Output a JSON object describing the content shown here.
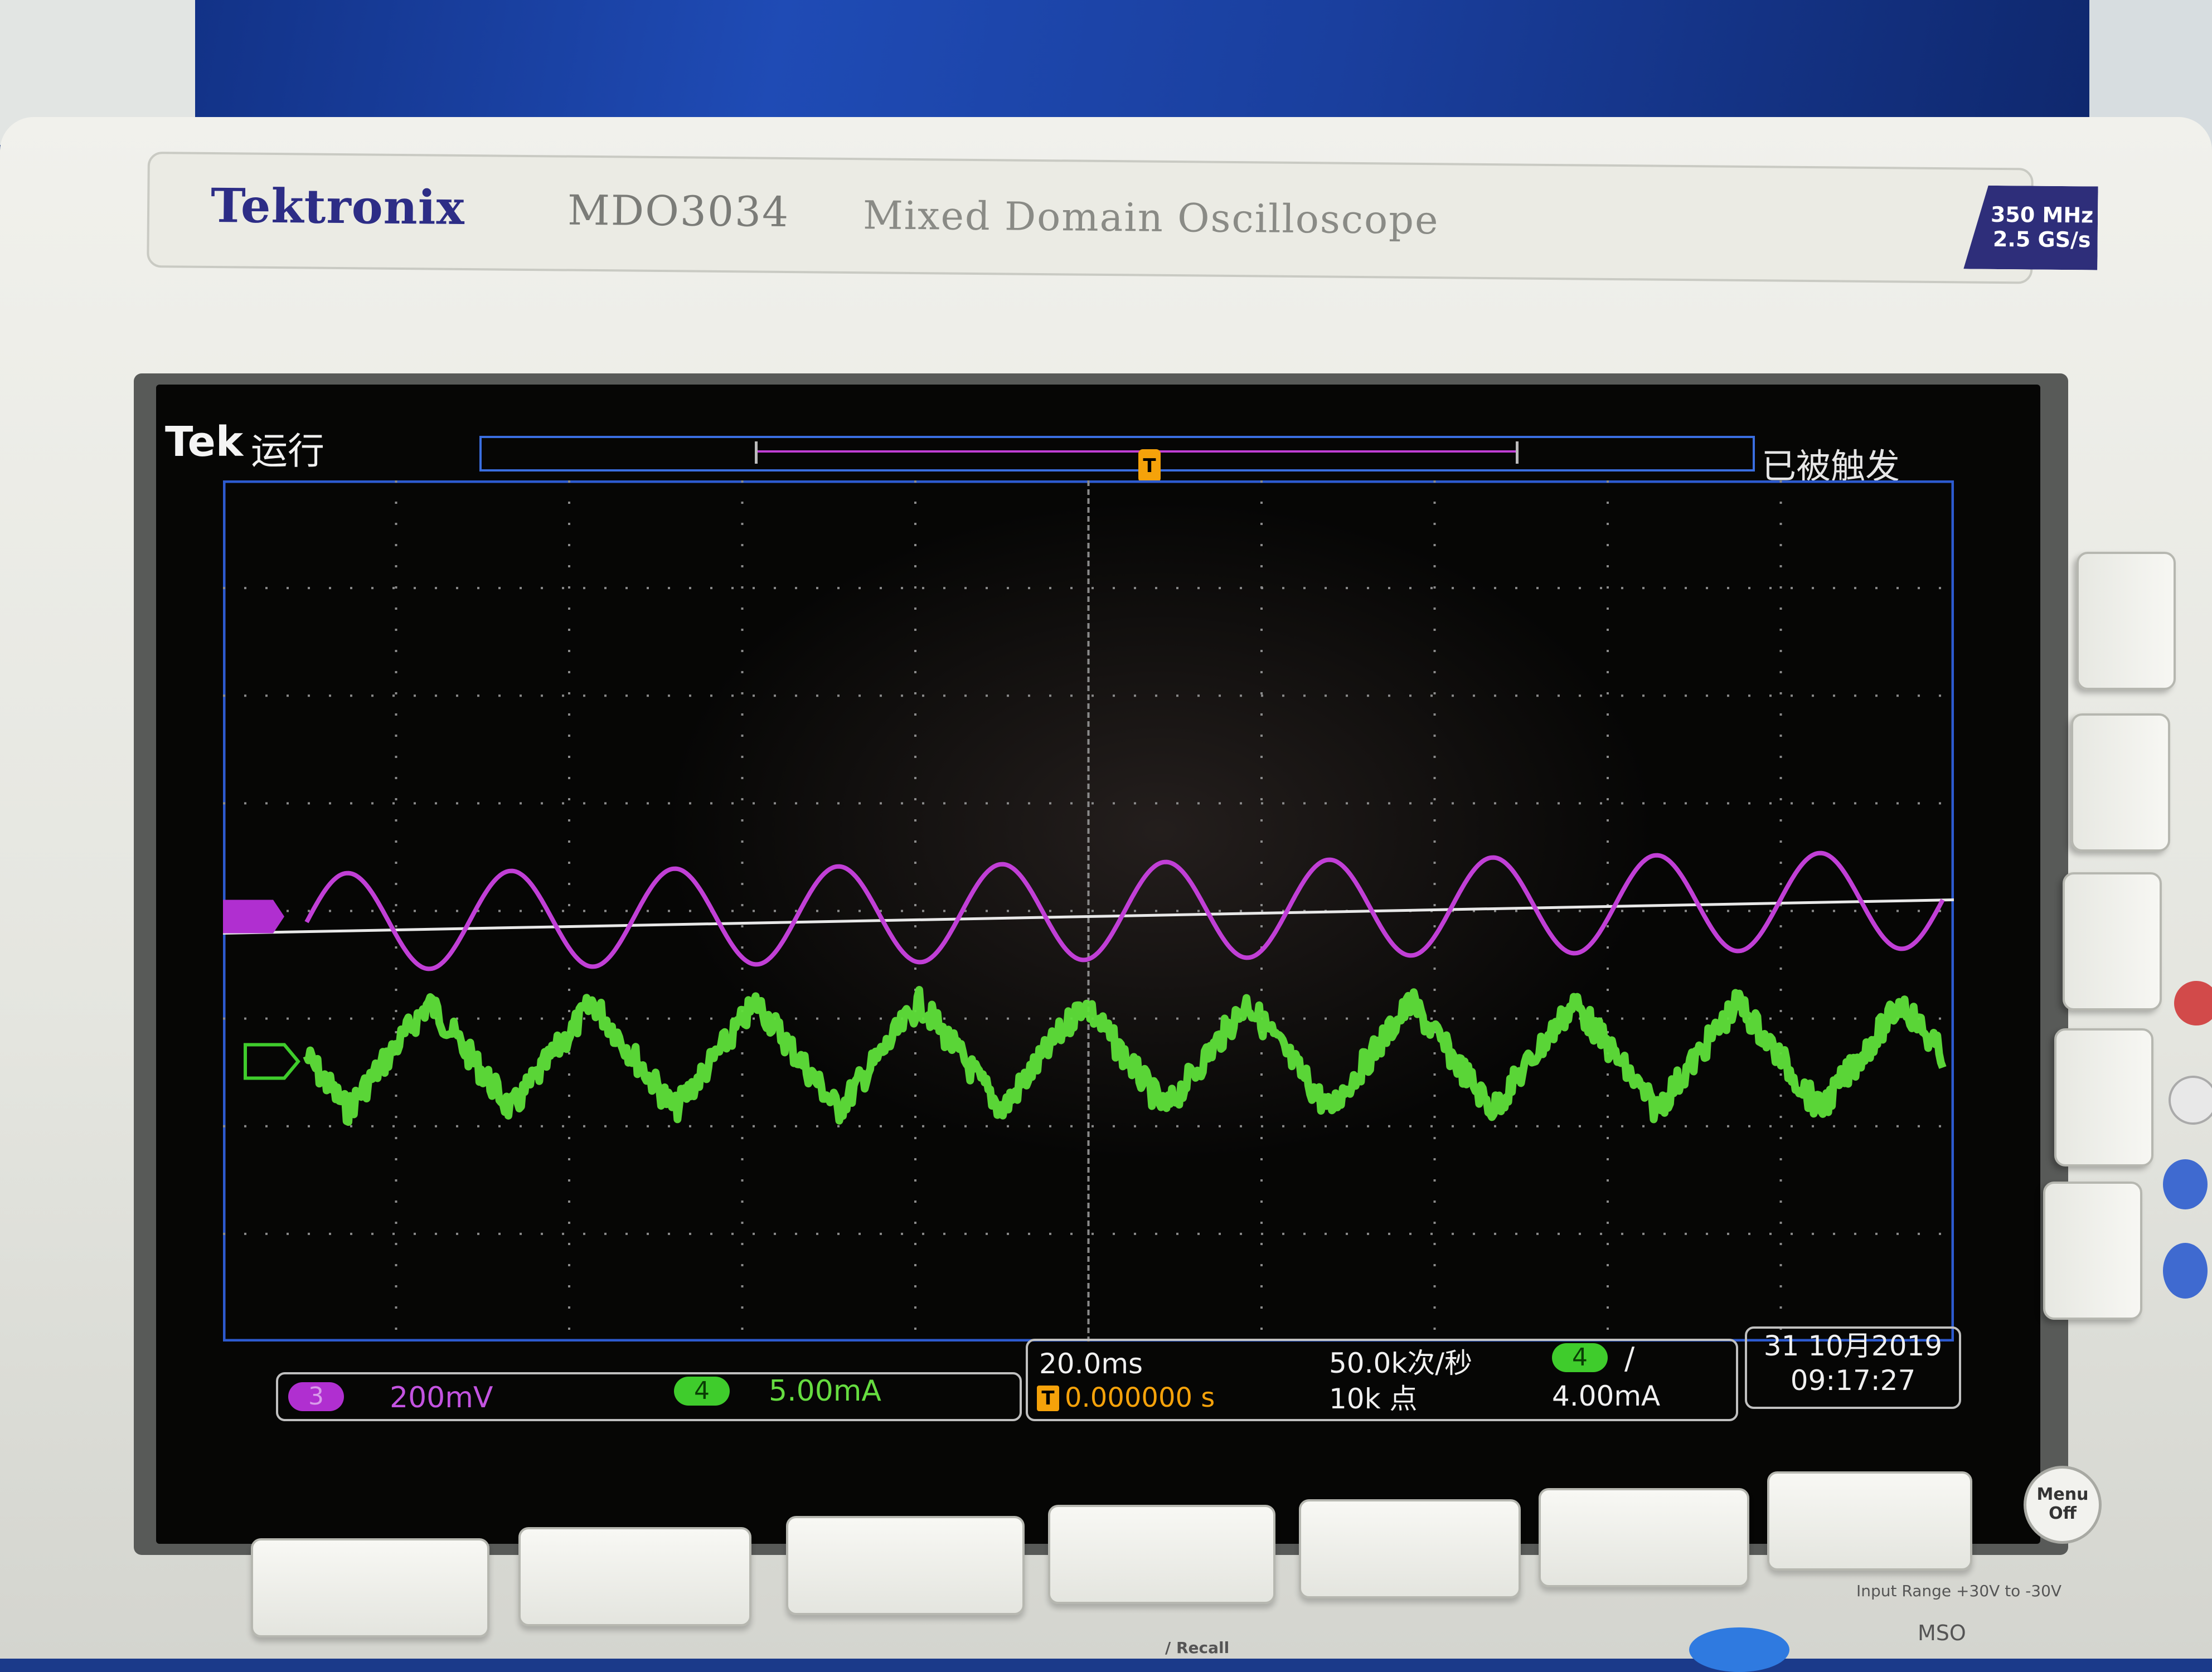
{
  "device": {
    "brand": "Tektronix",
    "model": "MDO3034",
    "description": "Mixed Domain Oscilloscope",
    "spec_bandwidth": "350 MHz",
    "spec_sample_rate": "2.5 GS/s"
  },
  "screen": {
    "header": {
      "logo": "Tek",
      "run_state": "运行",
      "trigger_state": "已被触发"
    },
    "channels": [
      {
        "id": "3",
        "scale": "200mV",
        "color": "#c13fd6"
      },
      {
        "id": "4",
        "scale": "5.00mA",
        "color": "#5fe03a"
      }
    ],
    "horizontal": {
      "timebase": "20.0ms",
      "trigger_position": "0.000000 s",
      "sample_rate": "50.0k次/秒",
      "record_length": "10k 点"
    },
    "trigger": {
      "channel": "4",
      "slope": "/",
      "level": "4.00mA",
      "marker": "T"
    },
    "datetime": {
      "date": "31 10月2019",
      "time": "09:17:27"
    }
  },
  "front_panel": {
    "menu_off_button": "Menu Off",
    "input_range_label": "Input Range +30V to -30V",
    "recall_label": "/ Recall",
    "mso_label": "MSO"
  },
  "chart_data": {
    "type": "line",
    "divisions_x": 10,
    "divisions_y": 8,
    "series": [
      {
        "name": "3",
        "waveform": "sine",
        "cycles_visible": 10,
        "amplitude_div": 0.45,
        "offset_div": 0.0
      },
      {
        "name": "4",
        "waveform": "triangle-with-noise",
        "cycles_visible": 10,
        "amplitude_div": 0.5,
        "offset_div": -1.35
      }
    ]
  }
}
